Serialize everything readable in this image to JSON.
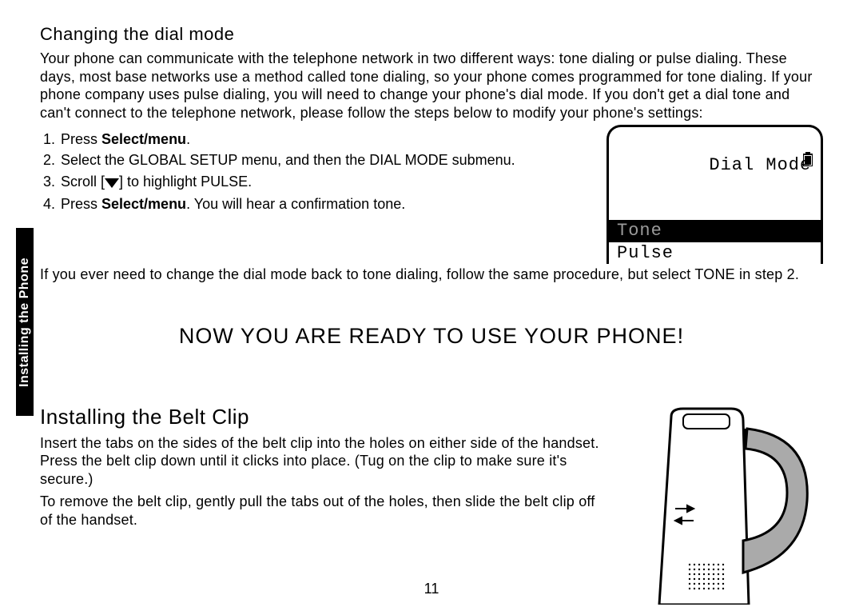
{
  "sideTab": "Installing the Phone",
  "dial": {
    "heading": "Changing the dial mode",
    "intro": "Your phone can communicate with the telephone network in two different ways: tone dialing or pulse dialing. These days, most base networks use a method called tone dialing, so your phone comes programmed for tone dialing. If your phone company uses pulse dialing, you will need to change your phone's dial mode. If you don't get a dial tone and can't connect to the telephone network, please follow the steps below to modify your phone's settings:",
    "steps": {
      "s1a": "Press ",
      "s1b": "Select/menu",
      "s1c": ".",
      "s2": "Select the GLOBAL SETUP menu, and then the DIAL MODE submenu.",
      "s3a": "Scroll [",
      "s3b": "] to highlight PULSE.",
      "s4a": "Press ",
      "s4b": "Select/menu",
      "s4c": ". You will hear a confirmation tone."
    },
    "note": "If you ever need to change the dial mode back to tone dialing, follow the same procedure, but select TONE in step 2.",
    "screen": {
      "title": "Dial Mode",
      "opt1": "Tone",
      "opt2": "Pulse"
    }
  },
  "ready": "NOW YOU ARE READY TO USE YOUR PHONE!",
  "belt": {
    "heading": "Installing the Belt Clip",
    "p1": "Insert the tabs on the sides of the belt clip into the holes on either side of the handset. Press the belt clip down until it clicks into place. (Tug on the clip to make sure it's secure.)",
    "p2": "To remove the belt clip, gently pull the tabs out of the holes, then slide the belt clip off of the handset."
  },
  "pageNum": "11"
}
